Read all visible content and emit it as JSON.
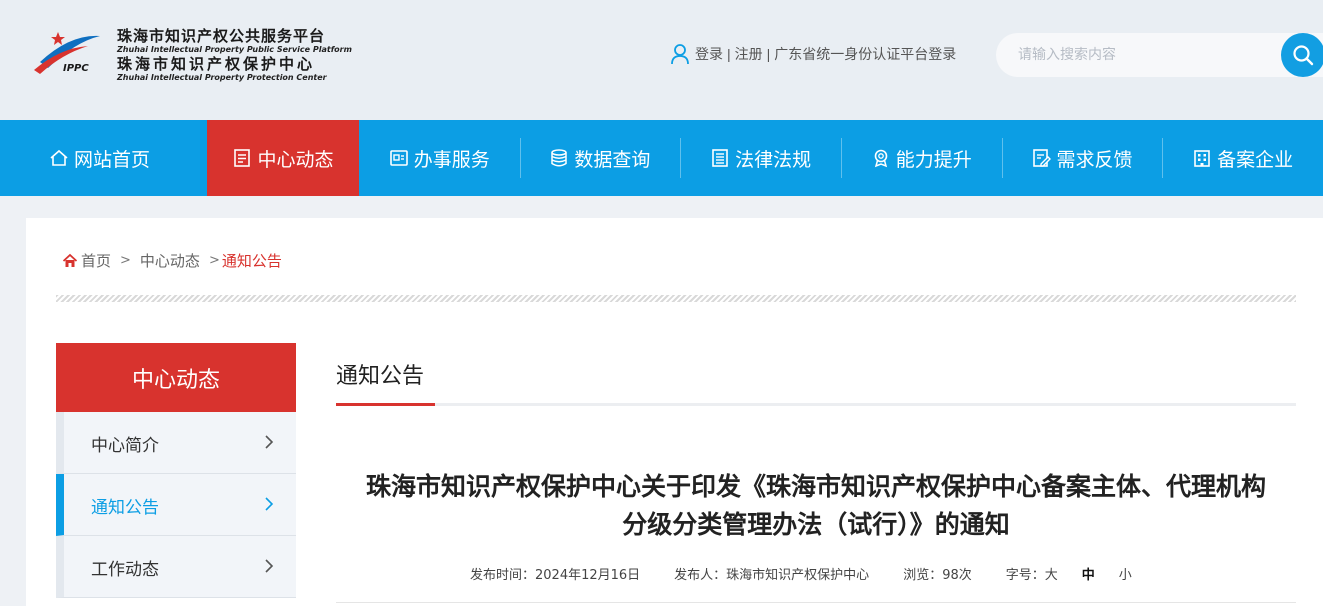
{
  "header": {
    "logo_cn_1": "珠海市知识产权公共服务平台",
    "logo_en_1": "Zhuhai Intellectual Property Public Service Platform",
    "logo_cn_2": "珠海市知识产权保护中心",
    "logo_en_2": "Zhuhai Intellectual Property Protection Center",
    "logo_badge": "IPPC",
    "login": "登录",
    "register": "注册",
    "separator": "|",
    "gd_login": "广东省统一身份认证平台登录",
    "search_placeholder": "请输入搜索内容"
  },
  "nav": {
    "items": [
      {
        "label": "网站首页",
        "icon": "home-icon"
      },
      {
        "label": "中心动态",
        "icon": "document-icon"
      },
      {
        "label": "办事服务",
        "icon": "service-icon"
      },
      {
        "label": "数据查询",
        "icon": "database-icon"
      },
      {
        "label": "法律法规",
        "icon": "book-icon"
      },
      {
        "label": "能力提升",
        "icon": "award-icon"
      },
      {
        "label": "需求反馈",
        "icon": "feedback-icon"
      },
      {
        "label": "备案企业",
        "icon": "building-icon"
      }
    ],
    "active_index": 1
  },
  "breadcrumb": {
    "home": "首页",
    "sep": ">",
    "level2": "中心动态",
    "current": "通知公告"
  },
  "sidebar": {
    "title": "中心动态",
    "items": [
      {
        "label": "中心简介"
      },
      {
        "label": "通知公告"
      },
      {
        "label": "工作动态"
      }
    ],
    "active_index": 1
  },
  "article": {
    "section_title": "通知公告",
    "title_line1": "珠海市知识产权保护中心关于印发《珠海市知识产权保护中心备案主体、代理机构",
    "title_line2": "分级分类管理办法（试行）》的通知",
    "publish_time": "发布时间：2024年12月16日",
    "publisher": "发布人：珠海市知识产权保护中心",
    "views": "浏览：98次",
    "font_size_label": "字号：",
    "font_large": "大",
    "font_medium": "中",
    "font_small": "小"
  },
  "colors": {
    "nav_blue": "#0c9ee4",
    "accent_red": "#d8332e"
  }
}
